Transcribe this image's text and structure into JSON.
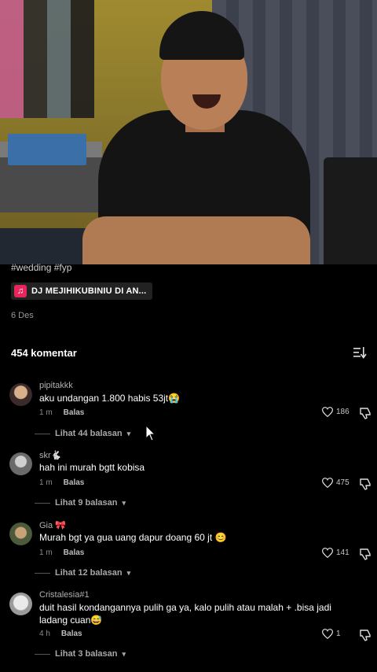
{
  "post": {
    "caption": "#wedding #fyp",
    "sound_label": "DJ MEJIHIKUBINIU DI AN...",
    "date": "6 Des",
    "icons": {
      "sound": "music-note-icon"
    },
    "accent_color": "#e8265e"
  },
  "comments_header": {
    "count_label": "454 komentar",
    "sort_icon": "sort-icon"
  },
  "comments": [
    {
      "username": "pipitakkk",
      "text": "aku undangan 1.800 habis 53jt😭",
      "time": "1 m",
      "reply_label": "Balas",
      "likes": "186",
      "view_replies": "Lihat 44 balasan"
    },
    {
      "username": "skr🐇",
      "text": "hah ini murah bgtt kobisa",
      "time": "1 m",
      "reply_label": "Balas",
      "likes": "475",
      "view_replies": "Lihat 9 balasan"
    },
    {
      "username": "Gia 🎀",
      "text": "Murah bgt ya gua uang dapur doang 60 jt 😊",
      "time": "1 m",
      "reply_label": "Balas",
      "likes": "141",
      "view_replies": "Lihat 12 balasan"
    },
    {
      "username": "Cristalesia#1",
      "text": "duit hasil kondangannya pulih ga ya, kalo pulih atau malah + .bisa jadi ladang cuan😅",
      "time": "4 h",
      "reply_label": "Balas",
      "likes": "1",
      "view_replies": "Lihat 3 balasan"
    }
  ]
}
